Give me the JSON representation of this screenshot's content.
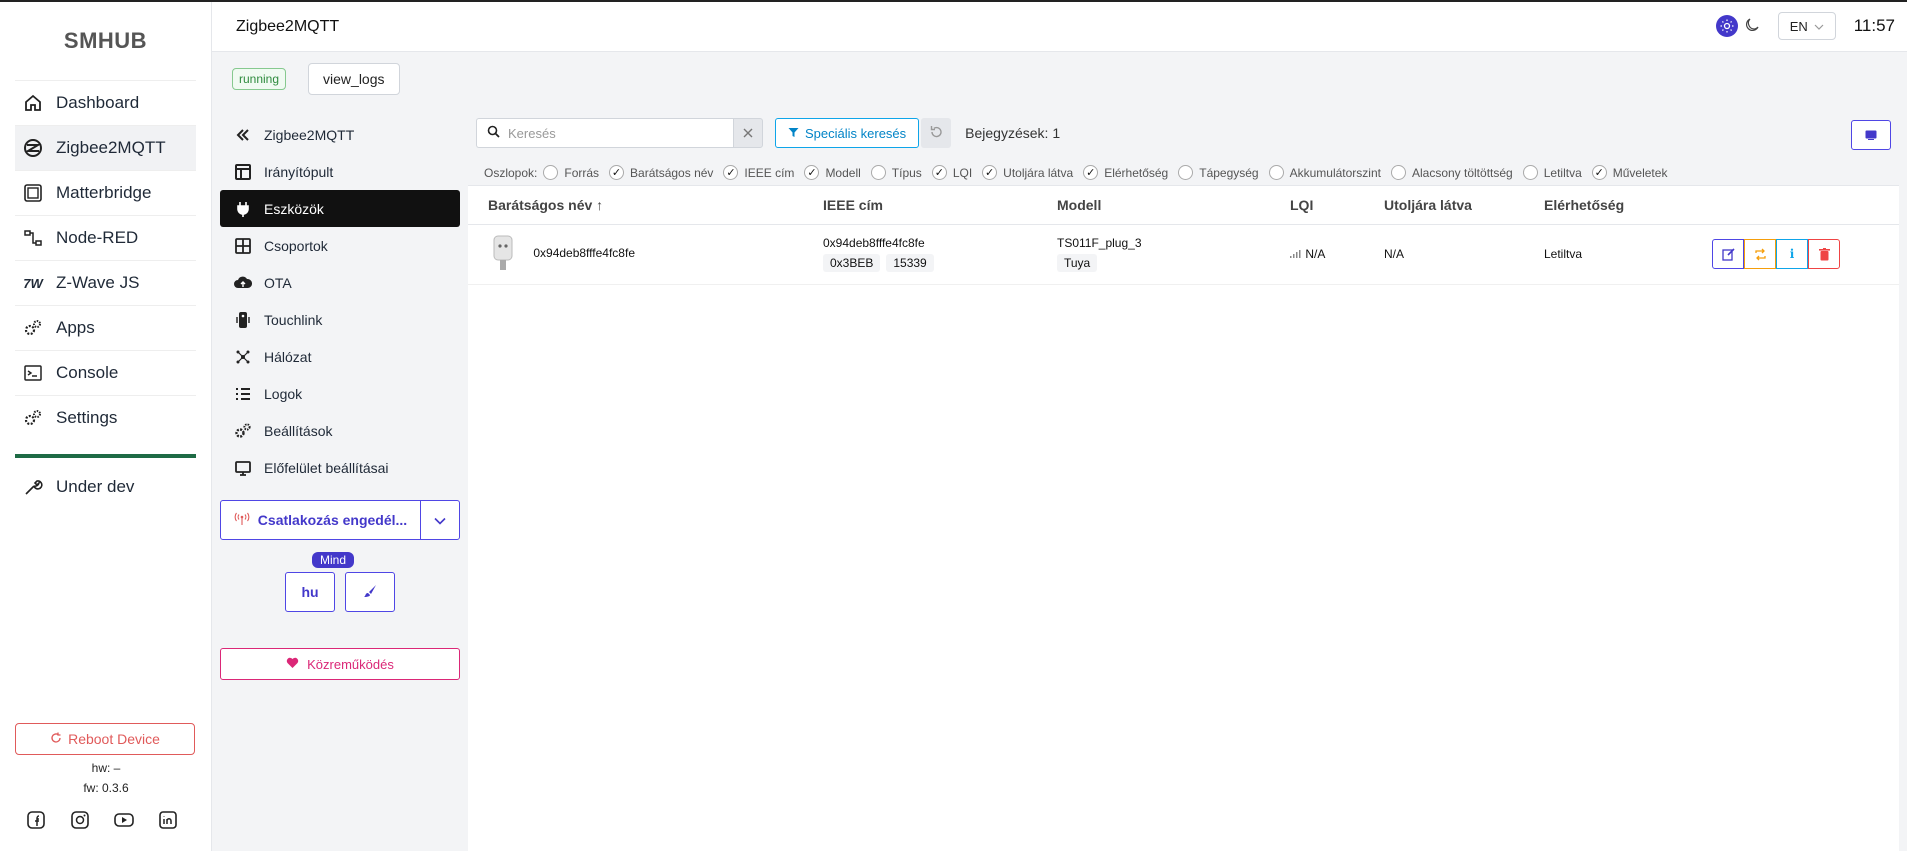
{
  "brand": "SMHUB",
  "nav": [
    {
      "label": "Dashboard",
      "icon": "home-icon"
    },
    {
      "label": "Zigbee2MQTT",
      "icon": "zigbee-icon",
      "active": true
    },
    {
      "label": "Matterbridge",
      "icon": "matter-icon"
    },
    {
      "label": "Node-RED",
      "icon": "nodered-icon"
    },
    {
      "label": "Z-Wave JS",
      "icon": "zwave-icon"
    },
    {
      "label": "Apps",
      "icon": "gears-icon"
    },
    {
      "label": "Console",
      "icon": "terminal-icon"
    },
    {
      "label": "Settings",
      "icon": "gears-icon"
    }
  ],
  "under_dev": "Under dev",
  "reboot_label": "Reboot Device",
  "hw": "hw: –",
  "fw": "fw: 0.3.6",
  "topbar": {
    "title": "Zigbee2MQTT",
    "lang": "EN",
    "clock": "11:57"
  },
  "status": {
    "running": "running",
    "view_logs": "view_logs"
  },
  "subnav": [
    {
      "label": "Zigbee2MQTT",
      "icon": "double-chevron-left-icon"
    },
    {
      "label": "Irányítópult",
      "icon": "dashboard-icon"
    },
    {
      "label": "Eszközök",
      "icon": "plug-icon",
      "active": true
    },
    {
      "label": "Csoportok",
      "icon": "grid-icon"
    },
    {
      "label": "OTA",
      "icon": "cloud-upload-icon"
    },
    {
      "label": "Touchlink",
      "icon": "remote-icon"
    },
    {
      "label": "Hálózat",
      "icon": "network-icon"
    },
    {
      "label": "Logok",
      "icon": "list-icon"
    },
    {
      "label": "Beállítások",
      "icon": "gears-icon"
    },
    {
      "label": "Előfelület beállításai",
      "icon": "monitor-icon"
    }
  ],
  "join": {
    "label": "Csatlakozás engedél...",
    "badge": "Mind"
  },
  "tools": {
    "lang": "hu"
  },
  "contribute": "Közreműködés",
  "toolbar": {
    "search_placeholder": "Keresés",
    "special": "Speciális keresés",
    "entries": "Bejegyzések: 1"
  },
  "columns_label": "Oszlopok:",
  "columns": [
    {
      "label": "Forrás",
      "checked": false
    },
    {
      "label": "Barátságos név",
      "checked": true
    },
    {
      "label": "IEEE cím",
      "checked": true
    },
    {
      "label": "Modell",
      "checked": true
    },
    {
      "label": "Típus",
      "checked": false
    },
    {
      "label": "LQI",
      "checked": true
    },
    {
      "label": "Utoljára látva",
      "checked": true
    },
    {
      "label": "Elérhetőség",
      "checked": true
    },
    {
      "label": "Tápegység",
      "checked": false
    },
    {
      "label": "Akkumulátorszint",
      "checked": false
    },
    {
      "label": "Alacsony töltöttség",
      "checked": false
    },
    {
      "label": "Letiltva",
      "checked": false
    },
    {
      "label": "Műveletek",
      "checked": true
    }
  ],
  "table": {
    "headers": [
      "Barátságos név ↑",
      "IEEE cím",
      "Modell",
      "LQI",
      "Utoljára látva",
      "Elérhetőség"
    ],
    "rows": [
      {
        "name": "0x94deb8fffe4fc8fe",
        "ieee": "0x94deb8fffe4fc8fe",
        "nwk_hex": "0x3BEB",
        "nwk_dec": "15339",
        "model": "TS011F_plug_3",
        "vendor": "Tuya",
        "lqi": "N/A",
        "last_seen": "N/A",
        "availability": "Letiltva"
      }
    ]
  },
  "colors": {
    "accent": "#4338ca",
    "danger": "#ef4444",
    "pink": "#db2777",
    "info": "#0ea5e9",
    "warning": "#f59e0b",
    "green": "#1e6b45"
  }
}
